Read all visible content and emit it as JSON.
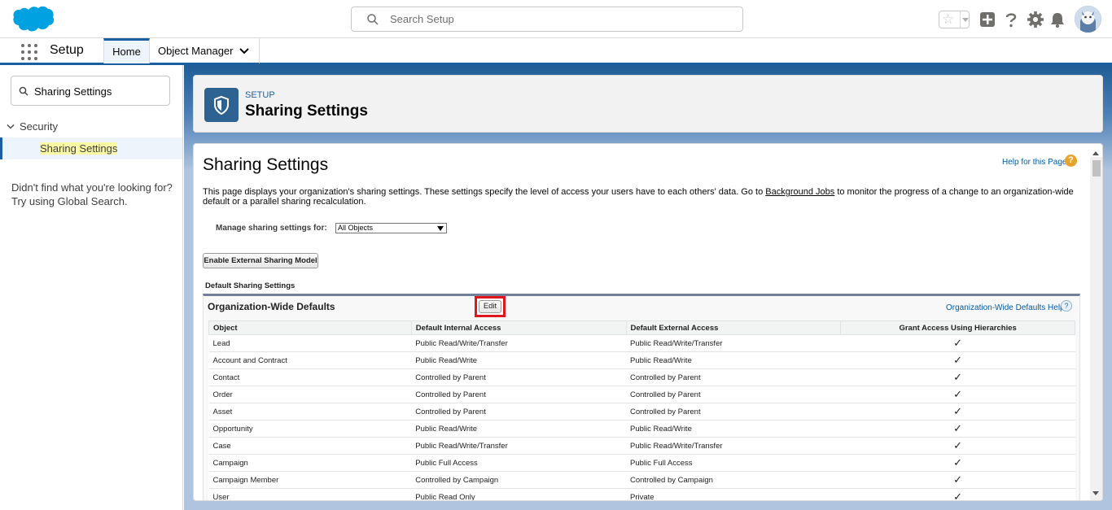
{
  "header": {
    "search_placeholder": "Search Setup",
    "icons": [
      "favorites-star-icon",
      "global-actions-plus-icon",
      "help-question-icon",
      "setup-gear-icon",
      "notifications-bell-icon",
      "user-avatar"
    ]
  },
  "nav": {
    "app_name": "Setup",
    "tabs": [
      {
        "label": "Home",
        "active": true
      },
      {
        "label": "Object Manager",
        "active": false
      }
    ]
  },
  "sidebar": {
    "quick_find_value": "Sharing Settings",
    "section": "Security",
    "selected_item": "Sharing Settings",
    "not_found_line1": "Didn't find what you're looking for?",
    "not_found_line2": "Try using Global Search."
  },
  "page_header": {
    "eyebrow": "SETUP",
    "title": "Sharing Settings"
  },
  "content": {
    "title": "Sharing Settings",
    "help_link": "Help for this Page",
    "description_before": "This page displays your organization's sharing settings. These settings specify the level of access your users have to each others' data. Go to ",
    "description_link": "Background Jobs",
    "description_after": " to monitor the progress of a change to an organization-wide default or a parallel sharing recalculation.",
    "manage_label": "Manage sharing settings for:",
    "manage_value": "All Objects",
    "external_button": "Enable External Sharing Model",
    "default_section": "Default Sharing Settings",
    "owd_title": "Organization-Wide Defaults",
    "edit_button": "Edit",
    "owd_help": "Organization-Wide Defaults Help",
    "columns": [
      "Object",
      "Default Internal Access",
      "Default External Access",
      "Grant Access Using Hierarchies"
    ],
    "rows": [
      {
        "object": "Lead",
        "internal": "Public Read/Write/Transfer",
        "external": "Public Read/Write/Transfer",
        "grant": "✓"
      },
      {
        "object": "Account and Contract",
        "internal": "Public Read/Write",
        "external": "Public Read/Write",
        "grant": "✓"
      },
      {
        "object": "Contact",
        "internal": "Controlled by Parent",
        "external": "Controlled by Parent",
        "grant": "✓"
      },
      {
        "object": "Order",
        "internal": "Controlled by Parent",
        "external": "Controlled by Parent",
        "grant": "✓"
      },
      {
        "object": "Asset",
        "internal": "Controlled by Parent",
        "external": "Controlled by Parent",
        "grant": "✓"
      },
      {
        "object": "Opportunity",
        "internal": "Public Read/Write",
        "external": "Public Read/Write",
        "grant": "✓"
      },
      {
        "object": "Case",
        "internal": "Public Read/Write/Transfer",
        "external": "Public Read/Write/Transfer",
        "grant": "✓"
      },
      {
        "object": "Campaign",
        "internal": "Public Full Access",
        "external": "Public Full Access",
        "grant": "✓"
      },
      {
        "object": "Campaign Member",
        "internal": "Controlled by Campaign",
        "external": "Controlled by Campaign",
        "grant": "✓"
      },
      {
        "object": "User",
        "internal": "Public Read Only",
        "external": "Private",
        "grant": "✓"
      }
    ]
  },
  "colors": {
    "brand_blue": "#1b5f9e",
    "salesforce_cloud": "#00a1e0",
    "highlight_red": "#e0161e",
    "help_orange": "#e8a32c"
  }
}
